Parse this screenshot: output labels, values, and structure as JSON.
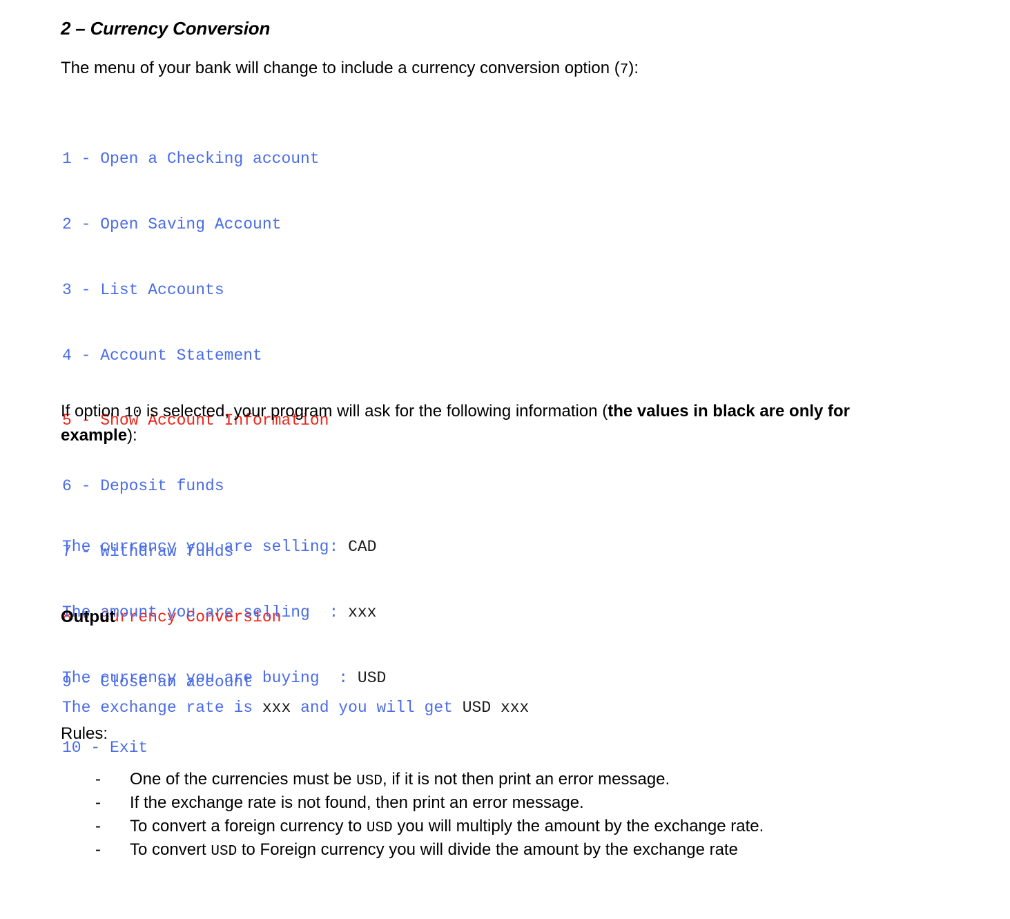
{
  "document": {
    "title": "2 – Currency Conversion",
    "intro": {
      "before": "The menu of your bank will change to include a currency conversion option (",
      "code": "7",
      "after": "):"
    },
    "menu": {
      "lines": [
        {
          "text": "1 - Open a Checking account",
          "color": "blue"
        },
        {
          "text": "2 - Open Saving Account",
          "color": "blue"
        },
        {
          "text": "3 - List Accounts",
          "color": "blue"
        },
        {
          "text": "4 - Account Statement",
          "color": "blue"
        },
        {
          "text": "5 - Show Account Information",
          "color": "red"
        },
        {
          "text": "6 - Deposit funds",
          "color": "blue"
        },
        {
          "text": "7 - Withdraw funds",
          "color": "blue"
        },
        {
          "text": "8 - Currency Conversion",
          "color": "red"
        },
        {
          "text": "9 - Close an account",
          "color": "blue"
        },
        {
          "text": "10 - Exit",
          "color": "blue"
        }
      ]
    },
    "option_note": {
      "part1": "If option ",
      "code": "10",
      "part2": " is selected, your program will ask for the following information (",
      "bold": "the values in black are only for example",
      "part3": "):"
    },
    "prompts": [
      {
        "label": "The currency you are selling",
        "sep": ": ",
        "value": "CAD"
      },
      {
        "label": "The amount you are selling",
        "sep": "  : ",
        "value": "xxx"
      },
      {
        "label": "The currency you are buying",
        "sep": "  : ",
        "value": "USD"
      }
    ],
    "output": {
      "heading": "Output",
      "line": {
        "seg1": "The exchange rate is ",
        "val1": "xxx",
        "seg2": " and you will get ",
        "val2": "USD xxx"
      }
    },
    "rules": {
      "heading": "Rules:",
      "bullet": "-",
      "items": [
        {
          "pre": "One of the currencies must be ",
          "code": "USD",
          "post": ", if it is not then print an error message."
        },
        {
          "pre": "If the exchange rate is not found, then print an error message.",
          "code": "",
          "post": ""
        },
        {
          "pre": "To convert a foreign currency to ",
          "code": "USD",
          "post": " you will multiply the amount by the exchange rate."
        },
        {
          "pre": "To convert ",
          "code": "USD",
          "post": " to Foreign currency you will divide the amount by the exchange rate"
        }
      ]
    },
    "colors": {
      "blue": "#4a6ce8",
      "red": "#ee2418",
      "black": "#1a1a1a"
    }
  }
}
